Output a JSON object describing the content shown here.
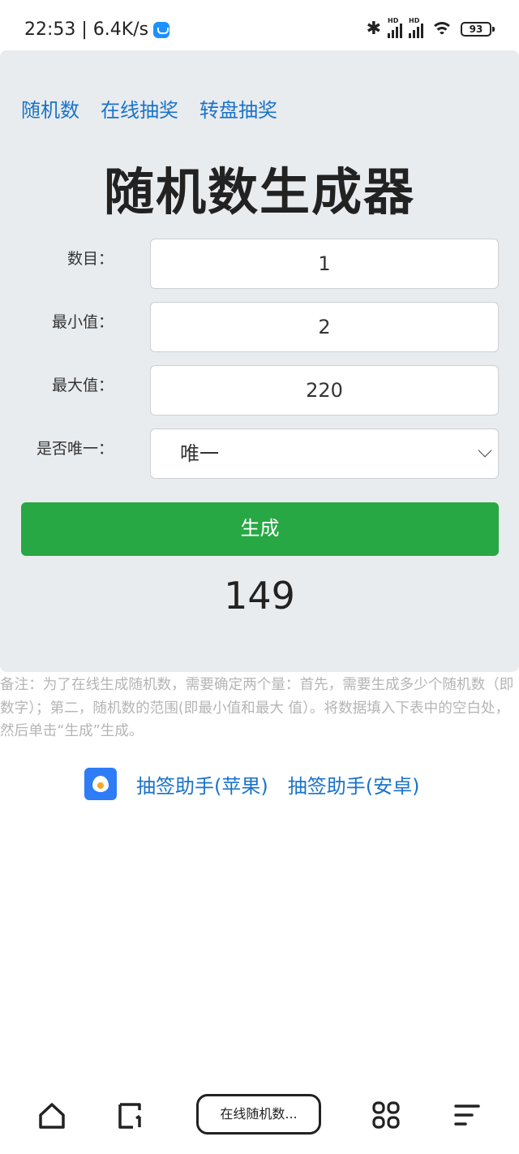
{
  "status": {
    "time_speed": "22:53 | 6.4K/s",
    "battery": "93"
  },
  "nav": {
    "links": [
      "随机数",
      "在线抽奖",
      "转盘抽奖"
    ]
  },
  "title": "随机数生成器",
  "form": {
    "count_label": "数目：",
    "count_value": "1",
    "min_label": "最小值：",
    "min_value": "2",
    "max_label": "最大值：",
    "max_value": "220",
    "unique_label": "是否唯一：",
    "unique_value": "唯一"
  },
  "generate_button": "生成",
  "result": "149",
  "note": "备注：为了在线生成随机数，需要确定两个量：首先，需要生成多少个随机数（即数字）；第二，随机数的范围(即最小值和最大 值）。将数据填入下表中的空白处，然后单击“生成”生成。",
  "apps": {
    "ios": "抽签助手(苹果)",
    "android": "抽签助手(安卓)"
  },
  "browser": {
    "tab_title": "在线随机数..."
  },
  "colors": {
    "accent_link": "#1a73c9",
    "button_green": "#28a745",
    "card_bg": "#e9ecef"
  }
}
